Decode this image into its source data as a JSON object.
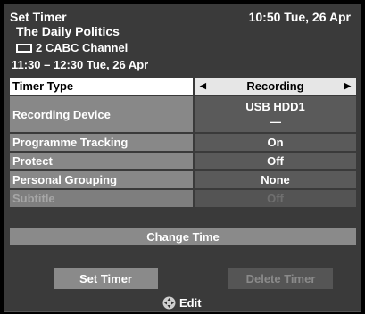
{
  "header": {
    "title": "Set Timer",
    "datetime": "10:50 Tue, 26 Apr",
    "programme": "The Daily Politics",
    "channel": "2 CABC Channel",
    "slot": "11:30 – 12:30 Tue, 26 Apr"
  },
  "rows": [
    {
      "label": "Timer Type",
      "value": "Recording"
    },
    {
      "label": "Recording Device",
      "value": "USB HDD1",
      "value2": "—"
    },
    {
      "label": "Programme Tracking",
      "value": "On"
    },
    {
      "label": "Protect",
      "value": "Off"
    },
    {
      "label": "Personal Grouping",
      "value": "None"
    },
    {
      "label": "Subtitle",
      "value": "Off"
    }
  ],
  "change_time": "Change Time",
  "buttons": {
    "set": "Set Timer",
    "delete": "Delete Timer"
  },
  "footer": {
    "edit": "Edit"
  },
  "colors": {
    "background": "#3a3a3a",
    "highlight": "#ffffff",
    "row": "#888888"
  }
}
